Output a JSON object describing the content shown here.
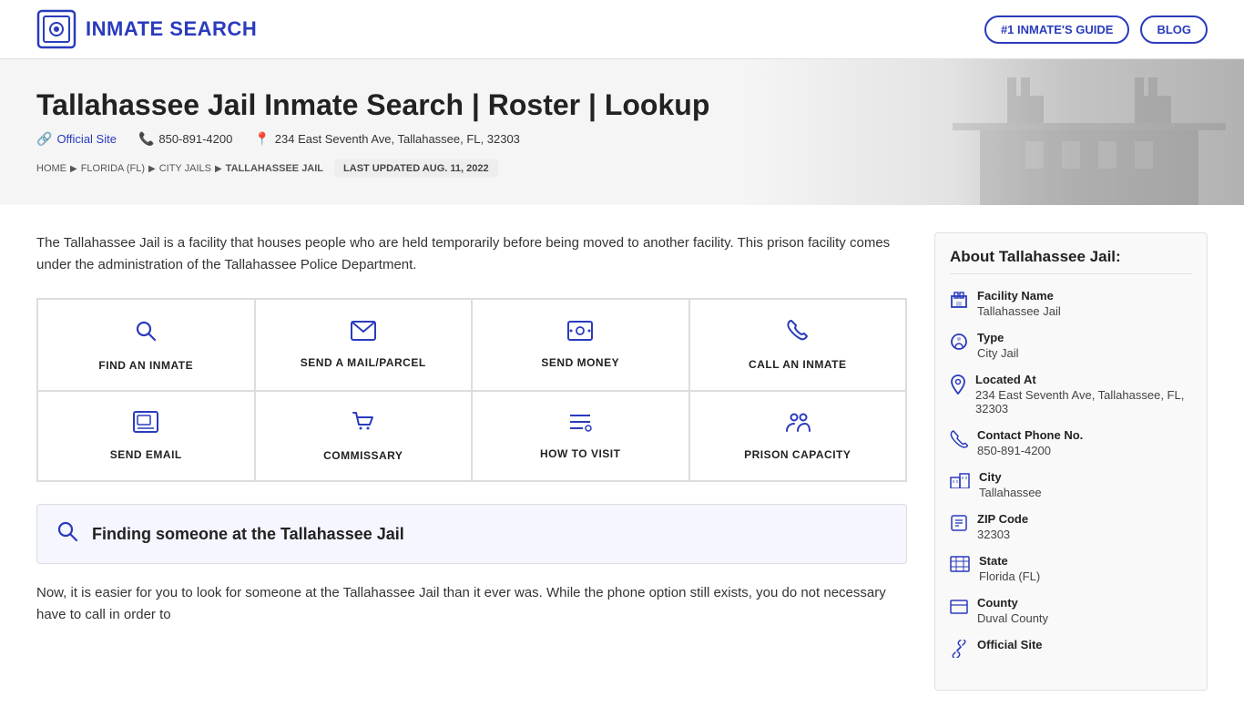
{
  "header": {
    "logo_text": "INMATE SEARCH",
    "nav": {
      "guide_label": "#1 INMATE'S GUIDE",
      "blog_label": "BLOG"
    }
  },
  "hero": {
    "title": "Tallahassee Jail Inmate Search | Roster | Lookup",
    "official_site_label": "Official Site",
    "phone": "850-891-4200",
    "address": "234 East Seventh Ave, Tallahassee, FL, 32303",
    "breadcrumb": {
      "home": "HOME",
      "florida": "FLORIDA (FL)",
      "city_jails": "CITY JAILS",
      "current": "TALLAHASSEE JAIL"
    },
    "last_updated": "LAST UPDATED AUG. 11, 2022"
  },
  "description": "The Tallahassee Jail is a facility that houses people who are held temporarily before being moved to another facility. This prison facility comes under the administration of the Tallahassee Police Department.",
  "action_grid": [
    {
      "icon": "🔍",
      "label": "FIND AN INMATE"
    },
    {
      "icon": "✉",
      "label": "SEND A MAIL/PARCEL"
    },
    {
      "icon": "💰",
      "label": "SEND MONEY"
    },
    {
      "icon": "📞",
      "label": "CALL AN INMATE"
    },
    {
      "icon": "🖥",
      "label": "SEND EMAIL"
    },
    {
      "icon": "🛒",
      "label": "COMMISSARY"
    },
    {
      "icon": "☰",
      "label": "HOW TO VISIT"
    },
    {
      "icon": "👥",
      "label": "PRISON CAPACITY"
    }
  ],
  "finding": {
    "title": "Finding someone at the Tallahassee Jail"
  },
  "body_text": "Now, it is easier for you to look for someone at the Tallahassee Jail than it ever was. While the phone option still exists, you do not necessary have to call in order to",
  "sidebar": {
    "heading": "About Tallahassee Jail:",
    "items": [
      {
        "icon": "🏛",
        "label": "Facility Name",
        "value": "Tallahassee Jail"
      },
      {
        "icon": "⚙",
        "label": "Type",
        "value": "City Jail"
      },
      {
        "icon": "📍",
        "label": "Located At",
        "value": "234 East Seventh Ave, Tallahassee, FL, 32303"
      },
      {
        "icon": "📞",
        "label": "Contact Phone No.",
        "value": "850-891-4200"
      },
      {
        "icon": "🏙",
        "label": "City",
        "value": "Tallahassee"
      },
      {
        "icon": "📮",
        "label": "ZIP Code",
        "value": "32303"
      },
      {
        "icon": "🗺",
        "label": "State",
        "value": "Florida (FL)"
      },
      {
        "icon": "🏢",
        "label": "County",
        "value": "Duval County"
      },
      {
        "icon": "🔗",
        "label": "Official Site",
        "value": ""
      }
    ]
  }
}
